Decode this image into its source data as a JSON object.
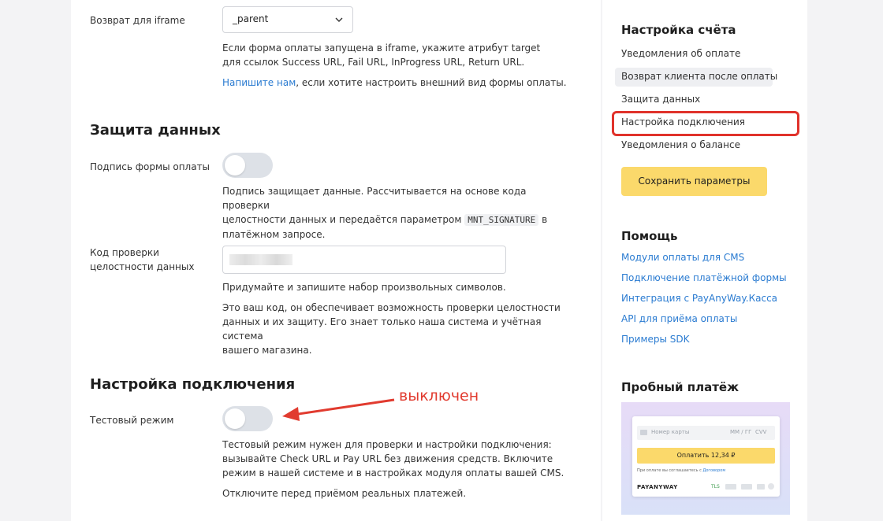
{
  "iframe_return": {
    "label": "Возврат для iframe",
    "select_value": "_parent",
    "help": "Если форма оплаты запущена в iframe, укажите атрибут target для ссылок Success URL, Fail URL, InProgress URL, Return URL.",
    "contact_link": "Напишите нам",
    "contact_rest": ", если хотите настроить внешний вид формы оплаты."
  },
  "data_protection": {
    "title": "Защита данных",
    "signature_label": "Подпись формы оплаты",
    "signature_enabled": false,
    "signature_help_1": "Подпись защищает данные. Рассчитывается на основе кода проверки",
    "signature_help_2": "целостности данных и передаётся параметром",
    "signature_param": "MNT_SIGNATURE",
    "signature_help_3": "в",
    "signature_help_4": "платёжном запросе.",
    "code_label_1": "Код проверки",
    "code_label_2": "целостности данных",
    "code_hint": "Придумайте и запишите набор произвольных символов.",
    "code_desc_1": "Это ваш код, он обеспечивает возможность проверки целостности",
    "code_desc_2": "данных и их защиту. Его знает только наша система и учётная система",
    "code_desc_3": "вашего магазина."
  },
  "connection": {
    "title": "Настройка подключения",
    "test_label": "Тестовый режим",
    "test_enabled": false,
    "annotation": "выключен",
    "test_help_1": "Тестовый режим нужен для проверки и настройки подключения:",
    "test_help_2": "вызывайте Check URL и Pay URL без движения средств. Включите",
    "test_help_3": "режим в нашей системе и в настройках модуля оплаты вашей CMS.",
    "test_note": "Отключите перед приёмом реальных платежей."
  },
  "sidebar": {
    "account_title": "Настройка счёта",
    "items": [
      "Уведомления об оплате",
      "Возврат клиента после оплаты",
      "Защита данных",
      "Настройка подключения",
      "Уведомления о балансе"
    ],
    "save_button": "Сохранить параметры",
    "help_title": "Помощь",
    "help_links": [
      "Модули оплаты для CMS",
      "Подключение платёжной формы",
      "Интеграция с PayAnyWay.Касса",
      "API для приёма оплаты",
      "Примеры SDK"
    ],
    "trial_title": "Пробный платёж",
    "trial_preview": {
      "card_placeholder": "Номер карты",
      "expiry_placeholder": "ММ / ГГ",
      "cvv_placeholder": "CVV",
      "pay_button": "Оплатить 12,34 ₽",
      "agreement": "При оплате вы соглашаетесь с",
      "agreement_link": "Договором",
      "brand": "PAYANYWAY",
      "tls": "TLS"
    }
  },
  "colors": {
    "accent_yellow": "#fbd96b",
    "link_blue": "#2a7bd1",
    "annotation_red": "#e13b2f"
  }
}
